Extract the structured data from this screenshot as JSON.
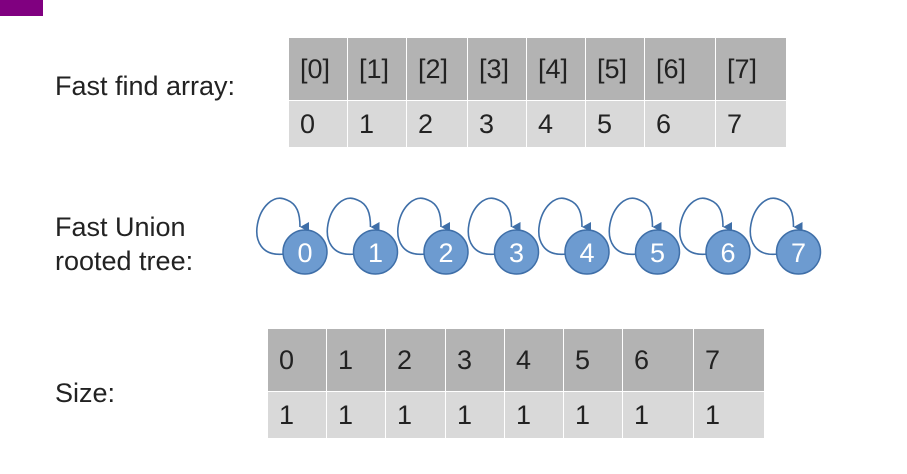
{
  "colors": {
    "corner_accent": "#800080",
    "node_fill": "#6d9bd0",
    "node_stroke": "#3f6fa8",
    "header_cell": "#b3b3b3",
    "value_cell": "#d9d9d9"
  },
  "fast_find": {
    "label": "Fast find array:",
    "indices": [
      "[0]",
      "[1]",
      "[2]",
      "[3]",
      "[4]",
      "[5]",
      "[6]",
      "[7]"
    ],
    "values": [
      "0",
      "1",
      "2",
      "3",
      "4",
      "5",
      "6",
      "7"
    ]
  },
  "fast_union": {
    "label_line1": "Fast Union",
    "label_line2": "rooted tree:",
    "nodes": [
      "0",
      "1",
      "2",
      "3",
      "4",
      "5",
      "6",
      "7"
    ]
  },
  "size": {
    "label": "Size:",
    "indices": [
      "0",
      "1",
      "2",
      "3",
      "4",
      "5",
      "6",
      "7"
    ],
    "values": [
      "1",
      "1",
      "1",
      "1",
      "1",
      "1",
      "1",
      "1"
    ]
  }
}
